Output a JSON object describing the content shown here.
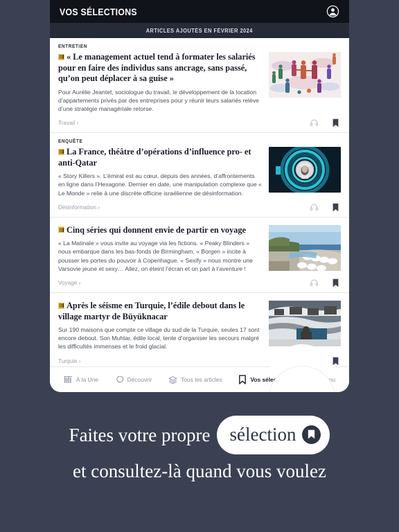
{
  "colors": {
    "page_background": "#3b4153",
    "header_background": "#11131a",
    "subheader_background": "#262b38",
    "card_background": "#ffffff",
    "premium_badge": "#f2c14b",
    "accent_text": "#1c1f29",
    "muted_text": "#9aa0ab"
  },
  "header": {
    "title": "VOS SÉLECTIONS",
    "account_icon": "account-circle-icon"
  },
  "subheader": {
    "label": "ARTICLES AJOUTÉS EN FÉVRIER 2024"
  },
  "articles": [
    {
      "kicker": "ENTRETIEN",
      "premium": true,
      "headline": "« Le management actuel tend à formater les salariés pour en faire des individus sans ancrage, sans passé, qu’on peut déplacer à sa guise »",
      "standfirst": "Pour Aurélie Jeantet, sociologue du travail, le développement de la location d’appartements privés par des entreprises pour y réunir leurs salariés relève d’une stratégie managériale retorse.",
      "topic": "Travail ›",
      "listen_icon": "headphones-icon",
      "bookmark_icon": "bookmark-filled-icon",
      "thumb_alt": "illustration-people-shaking-hands"
    },
    {
      "kicker": "ENQUÊTE",
      "premium": true,
      "headline": "La France, théâtre d’opérations d’influence pro- et anti-Qatar",
      "standfirst": "« Story Killers ». L’émirat est au cœur, depuis des années, d’affrontements en ligne dans l’Hexagone. Dernier en date, une manipulation complexe que « Le Monde » relie à une discrète officine israélienne de désinformation.",
      "topic": "Désinformation ›",
      "listen_icon": "headphones-icon",
      "bookmark_icon": "bookmark-filled-icon",
      "thumb_alt": "teal-concentric-circles-portrait"
    },
    {
      "kicker": "",
      "premium": true,
      "headline": "Cinq séries qui donnent envie de partir en voyage",
      "standfirst": "« La Matinale » vous invite au voyage via les fictions. « Peaky Blinders » nous embarque dans les bas-fonds de Birmingham, « Borgen » incite à pousser les portes du pouvoir à Copenhague, « Sexify » nous montre une Varsovie jeune et sexy… Allez, on éteint l’écran et on part à l’aventure !",
      "topic": "Voyage ›",
      "listen_icon": "headphones-icon",
      "bookmark_icon": "bookmark-filled-icon",
      "thumb_alt": "coastal-resort-pool-sea"
    },
    {
      "kicker": "",
      "premium": true,
      "headline": "Après le séisme en Turquie, l’édile debout dans le village martyr de Büyüknacar",
      "standfirst": "Sur 190 maisons que compte ce village du sud de la Turquie, seules 17 sont encore debout. Son Muhtar, édile local, tente d’organiser les secours malgré les difficultés immenses et le froid glacial.",
      "topic": "Turquie ›",
      "listen_icon": "headphones-icon",
      "bookmark_icon": "bookmark-filled-icon",
      "thumb_alt": "snowy-earthquake-village"
    }
  ],
  "nav": {
    "items": [
      {
        "label": "À la Une",
        "icon": "lemonde-m-icon",
        "active": false
      },
      {
        "label": "Découvrir",
        "icon": "scalloped-circle-icon",
        "active": false
      },
      {
        "label": "Tous les articles",
        "icon": "layers-stack-icon",
        "active": false
      },
      {
        "label": "Vos sélections",
        "icon": "bookmark-outline-icon",
        "active": true
      },
      {
        "label": "Menu",
        "icon": "lines-search-icon",
        "active": false
      }
    ]
  },
  "promo": {
    "line1_before": "Faites votre propre",
    "pill_label": "sélection",
    "pill_icon": "bookmark-filled-icon",
    "line2": "et consultez-là quand vous voulez"
  }
}
